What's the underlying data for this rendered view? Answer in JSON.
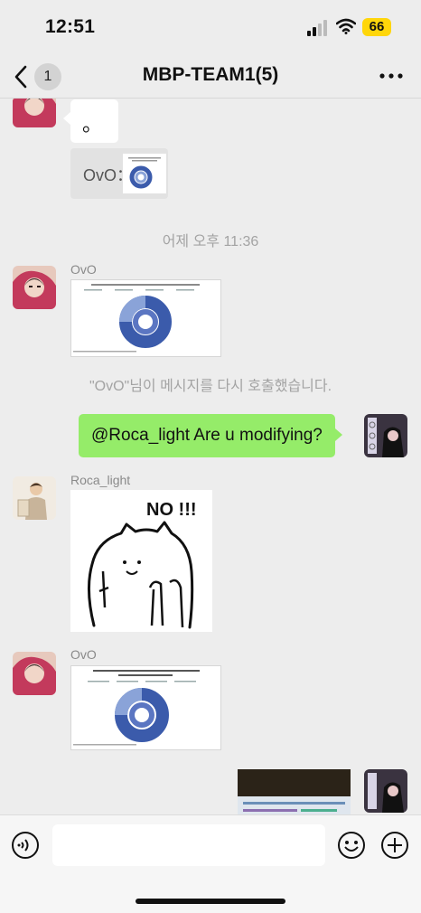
{
  "status": {
    "time": "12:51",
    "battery": "66"
  },
  "nav": {
    "back_count": "1",
    "title": "MBP-TEAM1(5)"
  },
  "messages": {
    "msg1_text": "。",
    "quote_text": "OvO：",
    "timestamp": "어제 오후 11:36",
    "sender_ovo": "OvO",
    "recall_notice": "\"OvO\"님이 메시지를 다시 호출했습니다.",
    "my_text": "@Roca_light Are u modifying?",
    "sender_roca": "Roca_light",
    "sticker_text": "NO !!!",
    "sender_ovo2": "OvO"
  },
  "chart_images": {
    "chart1_title": "TYPES OF TRAVEL PLANS MADE BY USERS IN THE PAST YEAR PRIOR TO TRAVELING",
    "chart2_title": "TYPES OF TRAVEL PLANS MADE BY USERS IN THE COMING YEAR PRIOR TO TRAVELING"
  },
  "colors": {
    "green_bubble": "#95ec69",
    "chart_blue": "#3b5bab",
    "chart_light": "#8aa3d8"
  },
  "icons": [
    "signal-icon",
    "wifi-icon",
    "battery-icon",
    "back-chevron-icon",
    "more-icon",
    "voice-icon",
    "emoji-icon",
    "plus-icon"
  ]
}
